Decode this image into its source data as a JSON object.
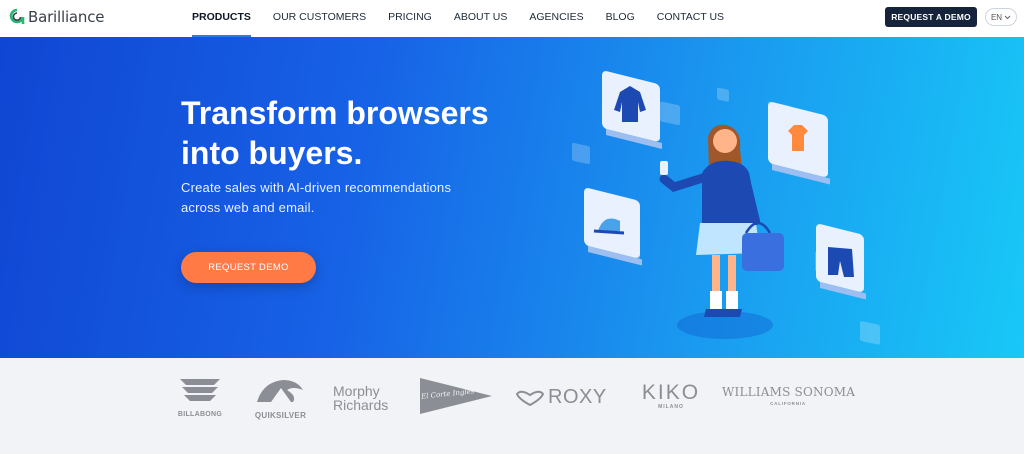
{
  "nav": {
    "logo_text": "Barilliance",
    "menu": [
      {
        "label": "PRODUCTS",
        "active": true
      },
      {
        "label": "OUR CUSTOMERS",
        "active": false
      },
      {
        "label": "PRICING",
        "active": false
      },
      {
        "label": "ABOUT US",
        "active": false
      },
      {
        "label": "AGENCIES",
        "active": false
      },
      {
        "label": "BLOG",
        "active": false
      },
      {
        "label": "CONTACT US",
        "active": false
      }
    ],
    "cta_label": "REQUEST A DEMO",
    "lang_label": "EN"
  },
  "hero": {
    "headline_line1": "Transform browsers",
    "headline_line2": "into buyers.",
    "subtitle_line1": "Create sales with AI-driven recommendations",
    "subtitle_line2": "across web and email.",
    "cta_label": "REQUEST DEMO"
  },
  "logos": [
    {
      "name": "billabong",
      "caption": "BILLABONG"
    },
    {
      "name": "quiksilver",
      "caption": "QUIKSILVER"
    },
    {
      "name": "morphy-richards",
      "line1": "Morphy",
      "line2": "Richards"
    },
    {
      "name": "el-corte-ingles",
      "text": "El Corte Inglés"
    },
    {
      "name": "roxy",
      "text": "ROXY"
    },
    {
      "name": "kiko",
      "text": "KIKO",
      "caption": "MILANO"
    },
    {
      "name": "williams-sonoma",
      "text": "WILLIAMS SONOMA",
      "caption": "CALIFORNIA"
    }
  ],
  "colors": {
    "accent": "#2a7de1",
    "cta_orange": "#ff7a45",
    "navy": "#16243b",
    "logo_gray": "#8b8e94"
  }
}
